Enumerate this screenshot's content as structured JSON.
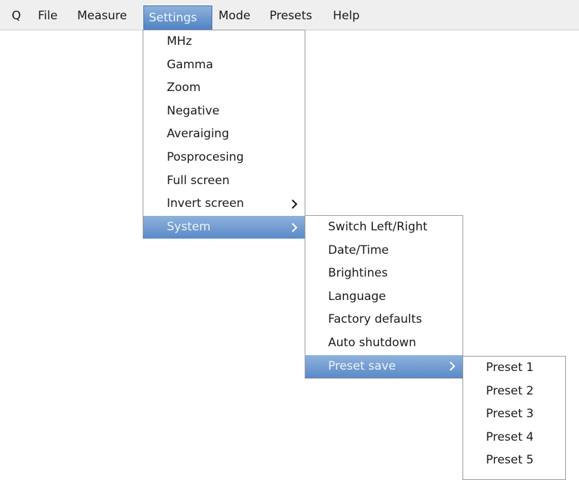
{
  "menubar": {
    "items": [
      "Q",
      "File",
      "Measure",
      "Settings",
      "Mode",
      "Presets",
      "Help"
    ],
    "active": "Settings"
  },
  "settings_menu": {
    "items": [
      {
        "label": "MHz"
      },
      {
        "label": "Gamma"
      },
      {
        "label": "Zoom"
      },
      {
        "label": "Negative"
      },
      {
        "label": "Averaiging"
      },
      {
        "label": "Posprocesing"
      },
      {
        "label": "Full screen"
      },
      {
        "label": "Invert screen",
        "submenu": true
      },
      {
        "label": "System",
        "submenu": true,
        "highlighted": true
      }
    ]
  },
  "system_menu": {
    "items": [
      {
        "label": "Switch Left/Right"
      },
      {
        "label": "Date/Time"
      },
      {
        "label": "Brightines"
      },
      {
        "label": "Language"
      },
      {
        "label": "Factory defaults"
      },
      {
        "label": "Auto shutdown"
      },
      {
        "label": "Preset save",
        "submenu": true,
        "highlighted": true
      }
    ]
  },
  "preset_menu": {
    "items": [
      {
        "label": "Preset 1"
      },
      {
        "label": "Preset 2"
      },
      {
        "label": "Preset 3"
      },
      {
        "label": "Preset 4"
      },
      {
        "label": "Preset 5"
      }
    ]
  },
  "colors": {
    "highlight": "#5a8ac8",
    "menubar_bg": "#efefef",
    "menu_border": "#9a9a9a"
  }
}
